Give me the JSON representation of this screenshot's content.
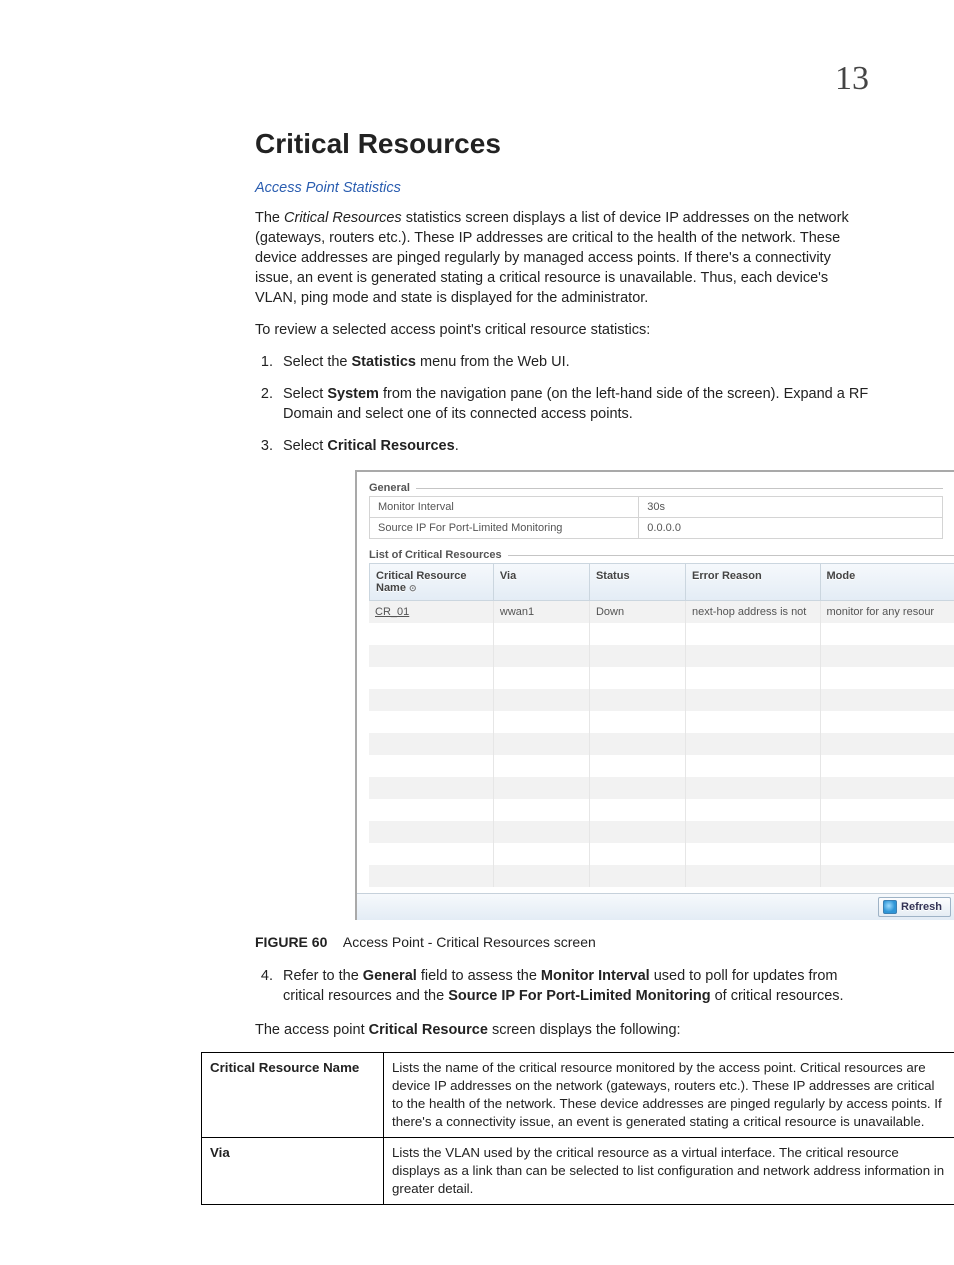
{
  "page_number": "13",
  "heading": "Critical Resources",
  "breadcrumb_link": "Access Point Statistics",
  "intro_html": "The <i>Critical Resources</i> statistics screen displays a list of device IP addresses on the network (gateways, routers etc.). These IP addresses are critical to the health of the  network. These device addresses are pinged regularly by managed access points. If there's a connectivity issue, an event is generated stating a critical resource is unavailable. Thus, each device's VLAN, ping mode and state is displayed for the administrator.",
  "lead_in": "To review a selected access point's critical resource statistics:",
  "steps": [
    "Select the <b>Statistics</b> menu from the Web UI.",
    "Select <b>System</b> from the navigation pane (on the left-hand side of the screen). Expand a RF Domain and select one of its connected access points.",
    "Select <b>Critical Resources</b>."
  ],
  "embed": {
    "general_label": "General",
    "kv": [
      {
        "k": "Monitor Interval",
        "v": "30s"
      },
      {
        "k": "Source IP For Port-Limited Monitoring",
        "v": "0.0.0.0"
      }
    ],
    "list_label": "List of Critical Resources",
    "headers": [
      "Critical Resource Name",
      "Via",
      "Status",
      "Error Reason",
      "Mode"
    ],
    "rows": [
      {
        "name": "CR_01",
        "via": "wwan1",
        "status": "Down",
        "error": "next-hop address is not",
        "mode": "monitor for any resour"
      }
    ],
    "empty_row_count": 12,
    "refresh_label": "Refresh"
  },
  "figure_label": "FIGURE 60",
  "figure_caption": "Access Point - Critical Resources screen",
  "step4_html": "Refer to the <b>General</b> field to assess the <b>Monitor Interval</b> used to poll for updates from critical resources and the <b>Source IP For Port-Limited Monitoring</b> of critical resources.",
  "after_steps_html": "The access point <b>Critical Resource</b> screen displays the following:",
  "field_table": [
    {
      "label": "Critical Resource Name",
      "desc": "Lists the name of the critical resource monitored by the access point. Critical resources are device IP addresses on the network (gateways, routers etc.). These IP addresses are critical to the health of the network. These device addresses are pinged regularly by access points. If there's a connectivity issue, an event is generated stating a critical resource is unavailable."
    },
    {
      "label": "Via",
      "desc": "Lists the VLAN used by the critical resource as a virtual interface. The critical resource displays as a link than can be selected to list configuration and network address information in greater detail."
    }
  ]
}
